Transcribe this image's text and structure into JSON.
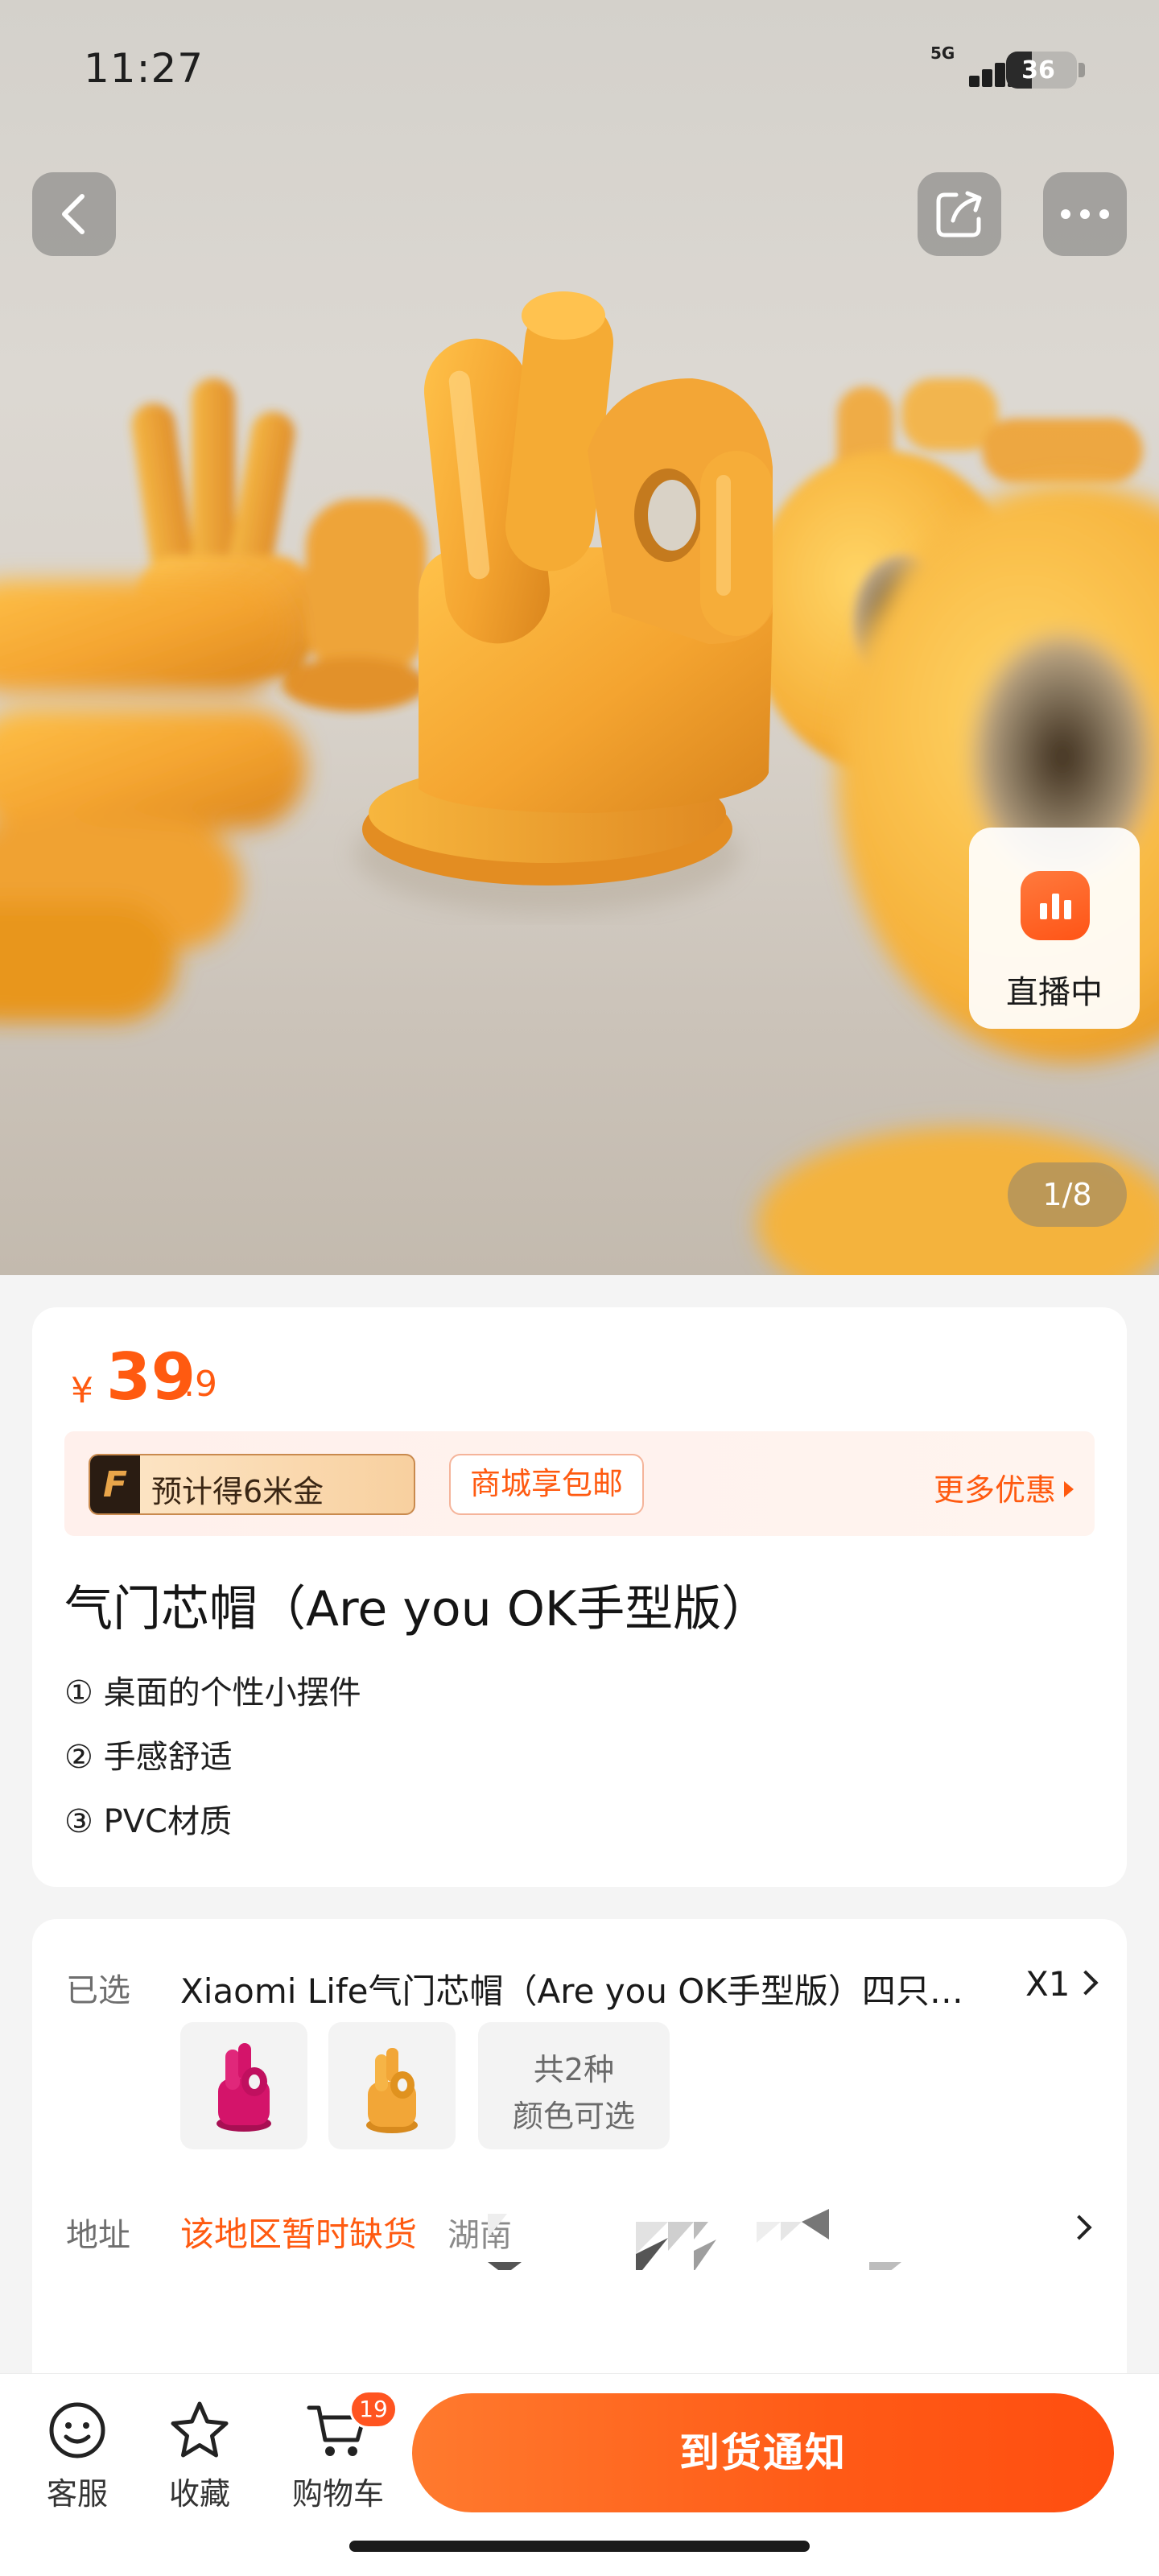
{
  "status_bar": {
    "time": "11:27",
    "network": "5G",
    "battery": "36",
    "battery_level": 0.36
  },
  "hero": {
    "image_counter": "1/8",
    "live_label": "直播中"
  },
  "product": {
    "price": {
      "currency": "¥",
      "integer": "39",
      "decimal": ".9"
    },
    "promo": {
      "coin_badge": "F",
      "coin_text": "预计得6米金",
      "shipping_tag": "商城享包邮",
      "more_deals": "更多优惠"
    },
    "title": "气门芯帽（Are you OK手型版）",
    "features": [
      "① 桌面的个性小摆件",
      "② 手感舒适",
      "③ PVC材质"
    ]
  },
  "selection": {
    "label": "已选",
    "value": "Xiaomi Life气门芯帽（Are you OK手型版）四只装…",
    "quantity": "X1",
    "swatches": [
      {
        "color_name": "magenta",
        "color": "#d4146a"
      },
      {
        "color_name": "yellow",
        "color": "#f2a637"
      }
    ],
    "variants_line1": "共2种",
    "variants_line2": "颜色可选"
  },
  "address": {
    "label": "地址",
    "status": "该地区暂时缺货",
    "location": "湖南"
  },
  "bottom_bar": {
    "service_label": "客服",
    "favorite_label": "收藏",
    "cart_label": "购物车",
    "cart_count": "19",
    "notify_button": "到货通知"
  },
  "colors": {
    "accent": "#ff5a10",
    "accent_gradient_end": "#ff4e10",
    "product_yellow": "#f2a637"
  }
}
